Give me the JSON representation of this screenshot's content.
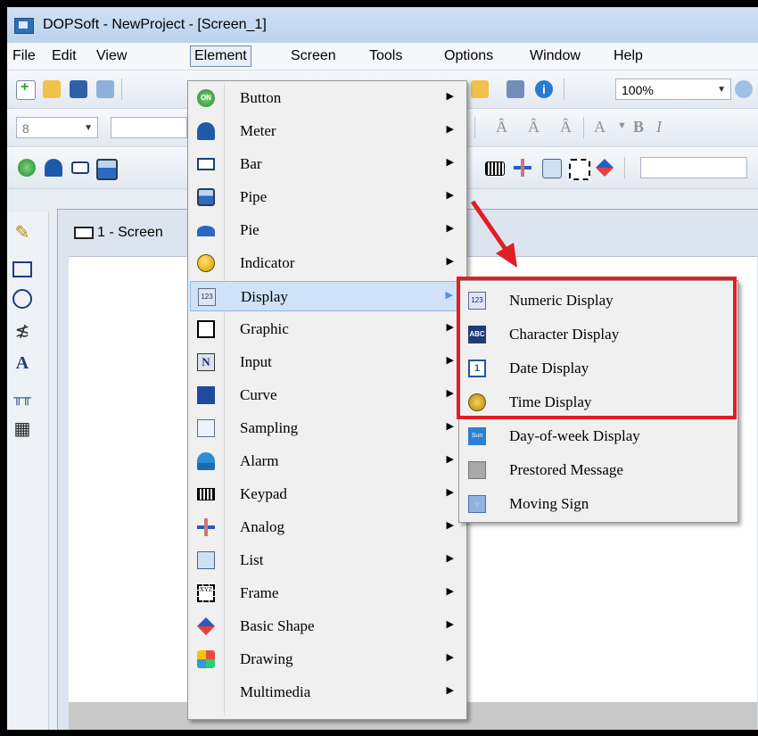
{
  "title": "DOPSoft - NewProject - [Screen_1]",
  "menubar": [
    "File",
    "Edit",
    "View",
    "Element",
    "Screen",
    "Tools",
    "Options",
    "Window",
    "Help"
  ],
  "toolbar": {
    "zoom": "100%",
    "font_size": "8"
  },
  "document": {
    "tab_label": "1 - Screen"
  },
  "element_menu": [
    {
      "label": "Button",
      "icon": "on-button-icon",
      "submenu": true
    },
    {
      "label": "Meter",
      "icon": "meter-icon",
      "submenu": true
    },
    {
      "label": "Bar",
      "icon": "bar-icon",
      "submenu": true
    },
    {
      "label": "Pipe",
      "icon": "pipe-icon",
      "submenu": true
    },
    {
      "label": "Pie",
      "icon": "pie-icon",
      "submenu": true
    },
    {
      "label": "Indicator",
      "icon": "indicator-icon",
      "submenu": true
    },
    {
      "label": "Display",
      "icon": "display-123-icon",
      "submenu": true,
      "highlighted": true
    },
    {
      "label": "Graphic",
      "icon": "graphic-icon",
      "submenu": true
    },
    {
      "label": "Input",
      "icon": "input-icon",
      "submenu": true
    },
    {
      "label": "Curve",
      "icon": "curve-icon",
      "submenu": true
    },
    {
      "label": "Sampling",
      "icon": "sampling-icon",
      "submenu": true
    },
    {
      "label": "Alarm",
      "icon": "alarm-icon",
      "submenu": true
    },
    {
      "label": "Keypad",
      "icon": "keypad-icon",
      "submenu": true
    },
    {
      "label": "Analog",
      "icon": "analog-icon",
      "submenu": true
    },
    {
      "label": "List",
      "icon": "list-icon",
      "submenu": true
    },
    {
      "label": "Frame",
      "icon": "frame-icon",
      "submenu": true
    },
    {
      "label": "Basic Shape",
      "icon": "basic-shape-icon",
      "submenu": true
    },
    {
      "label": "Drawing",
      "icon": "drawing-icon",
      "submenu": true
    },
    {
      "label": "Multimedia",
      "icon": "",
      "submenu": true
    }
  ],
  "display_submenu": [
    {
      "label": "Numeric Display",
      "icon": "numeric-display-icon"
    },
    {
      "label": "Character Display",
      "icon": "character-display-icon"
    },
    {
      "label": "Date Display",
      "icon": "date-display-icon"
    },
    {
      "label": "Time Display",
      "icon": "time-display-icon"
    },
    {
      "label": "Day-of-week Display",
      "icon": "day-of-week-icon"
    },
    {
      "label": "Prestored Message",
      "icon": "prestored-message-icon"
    },
    {
      "label": "Moving Sign",
      "icon": "moving-sign-icon"
    }
  ],
  "icon_text": {
    "on": "ON",
    "n123": "123",
    "abc": "ABC",
    "sun": "Sun",
    "date": "1",
    "input": "N",
    "frame": "XYZ"
  },
  "colors": {
    "highlight_box": "#e01e26",
    "selected_row": "#cfe2f8"
  }
}
